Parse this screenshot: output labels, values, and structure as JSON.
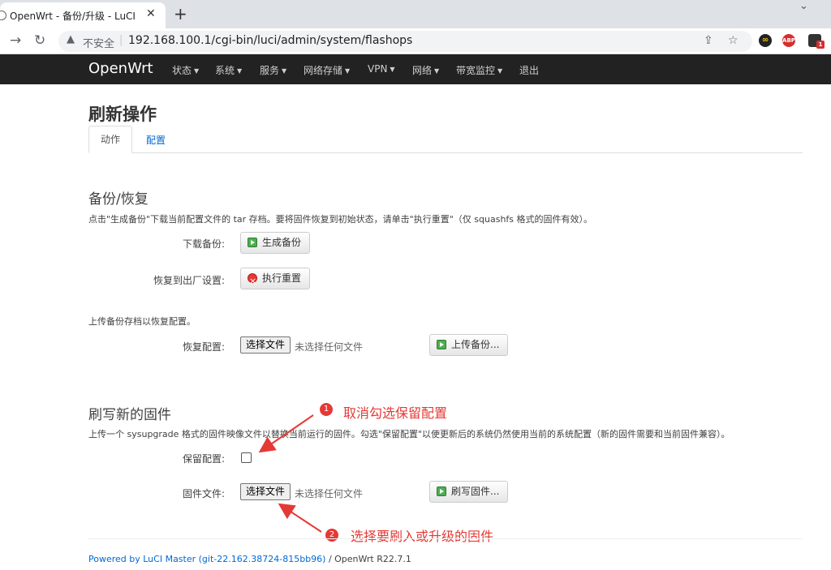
{
  "browser": {
    "tab_title": "OpenWrt - 备份/升级 - LuCI",
    "close": "✕",
    "new_tab": "+",
    "chevron": "⌄",
    "insecure": "不安全",
    "url": "192.168.100.1/cgi-bin/luci/admin/system/flashops",
    "ext_abp": "ABP",
    "ext_badge": "1"
  },
  "navbar": {
    "brand": "OpenWrt",
    "menus": [
      "状态",
      "系统",
      "服务",
      "网络存储",
      "VPN",
      "网络",
      "带宽监控",
      "退出"
    ]
  },
  "page": {
    "title": "刷新操作",
    "tabs": [
      "动作",
      "配置"
    ]
  },
  "backup": {
    "heading": "备份/恢复",
    "desc": "点击\"生成备份\"下载当前配置文件的 tar 存档。要将固件恢复到初始状态，请单击\"执行重置\"（仅 squashfs 格式的固件有效）。",
    "download_label": "下载备份:",
    "generate_btn": "生成备份",
    "factory_label": "恢复到出厂设置:",
    "reset_btn": "执行重置",
    "upload_desc": "上传备份存档以恢复配置。",
    "restore_label": "恢复配置:",
    "choose_file": "选择文件",
    "no_file": "未选择任何文件",
    "upload_btn": "上传备份..."
  },
  "flash": {
    "heading": "刷写新的固件",
    "desc": "上传一个 sysupgrade 格式的固件映像文件以替换当前运行的固件。勾选\"保留配置\"以使更新后的系统仍然使用当前的系统配置（新的固件需要和当前固件兼容）。",
    "keep_label": "保留配置:",
    "image_label": "固件文件:",
    "choose_file": "选择文件",
    "no_file": "未选择任何文件",
    "flash_btn": "刷写固件..."
  },
  "annotations": {
    "n1": "1",
    "text1": "取消勾选保留配置",
    "n2": "2",
    "text2": "选择要刷入或升级的固件"
  },
  "footer": {
    "link": "Powered by LuCI Master (git-22.162.38724-815bb96)",
    "version": " / OpenWrt R22.7.1"
  }
}
